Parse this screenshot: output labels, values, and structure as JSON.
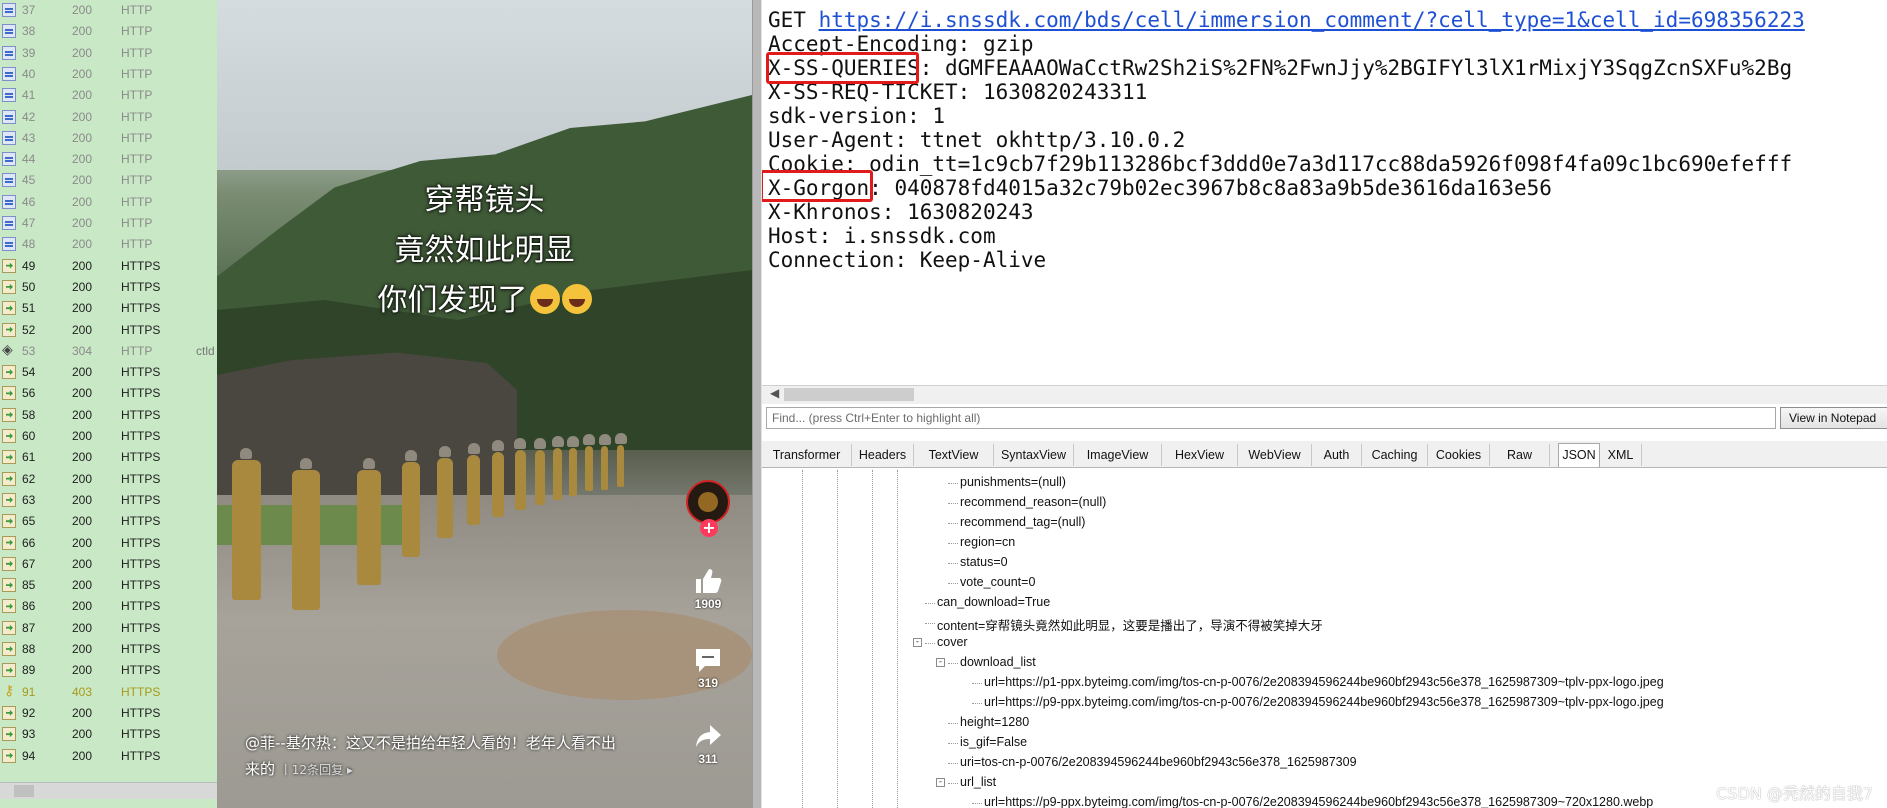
{
  "sessions": [
    {
      "num": "37",
      "code": "200",
      "proto": "HTTP",
      "icon": "http",
      "host": ""
    },
    {
      "num": "38",
      "code": "200",
      "proto": "HTTP",
      "icon": "http",
      "host": ""
    },
    {
      "num": "39",
      "code": "200",
      "proto": "HTTP",
      "icon": "http",
      "host": ""
    },
    {
      "num": "40",
      "code": "200",
      "proto": "HTTP",
      "icon": "http",
      "host": ""
    },
    {
      "num": "41",
      "code": "200",
      "proto": "HTTP",
      "icon": "http",
      "host": ""
    },
    {
      "num": "42",
      "code": "200",
      "proto": "HTTP",
      "icon": "http",
      "host": ""
    },
    {
      "num": "43",
      "code": "200",
      "proto": "HTTP",
      "icon": "http",
      "host": ""
    },
    {
      "num": "44",
      "code": "200",
      "proto": "HTTP",
      "icon": "http",
      "host": ""
    },
    {
      "num": "45",
      "code": "200",
      "proto": "HTTP",
      "icon": "http",
      "host": ""
    },
    {
      "num": "46",
      "code": "200",
      "proto": "HTTP",
      "icon": "http",
      "host": ""
    },
    {
      "num": "47",
      "code": "200",
      "proto": "HTTP",
      "icon": "http",
      "host": ""
    },
    {
      "num": "48",
      "code": "200",
      "proto": "HTTP",
      "icon": "http",
      "host": ""
    },
    {
      "num": "49",
      "code": "200",
      "proto": "HTTPS",
      "icon": "https",
      "host": ""
    },
    {
      "num": "50",
      "code": "200",
      "proto": "HTTPS",
      "icon": "https",
      "host": ""
    },
    {
      "num": "51",
      "code": "200",
      "proto": "HTTPS",
      "icon": "https",
      "host": ""
    },
    {
      "num": "52",
      "code": "200",
      "proto": "HTTPS",
      "icon": "https",
      "host": ""
    },
    {
      "num": "53",
      "code": "304",
      "proto": "HTTP",
      "icon": "c304",
      "host": "ctld"
    },
    {
      "num": "54",
      "code": "200",
      "proto": "HTTPS",
      "icon": "https",
      "host": ""
    },
    {
      "num": "56",
      "code": "200",
      "proto": "HTTPS",
      "icon": "https",
      "host": ""
    },
    {
      "num": "58",
      "code": "200",
      "proto": "HTTPS",
      "icon": "https",
      "host": ""
    },
    {
      "num": "60",
      "code": "200",
      "proto": "HTTPS",
      "icon": "https",
      "host": ""
    },
    {
      "num": "61",
      "code": "200",
      "proto": "HTTPS",
      "icon": "https",
      "host": ""
    },
    {
      "num": "62",
      "code": "200",
      "proto": "HTTPS",
      "icon": "https",
      "host": ""
    },
    {
      "num": "63",
      "code": "200",
      "proto": "HTTPS",
      "icon": "https",
      "host": ""
    },
    {
      "num": "65",
      "code": "200",
      "proto": "HTTPS",
      "icon": "https",
      "host": ""
    },
    {
      "num": "66",
      "code": "200",
      "proto": "HTTPS",
      "icon": "https",
      "host": ""
    },
    {
      "num": "67",
      "code": "200",
      "proto": "HTTPS",
      "icon": "https",
      "host": ""
    },
    {
      "num": "85",
      "code": "200",
      "proto": "HTTPS",
      "icon": "https",
      "host": ""
    },
    {
      "num": "86",
      "code": "200",
      "proto": "HTTPS",
      "icon": "https",
      "host": ""
    },
    {
      "num": "87",
      "code": "200",
      "proto": "HTTPS",
      "icon": "https",
      "host": ""
    },
    {
      "num": "88",
      "code": "200",
      "proto": "HTTPS",
      "icon": "https",
      "host": ""
    },
    {
      "num": "89",
      "code": "200",
      "proto": "HTTPS",
      "icon": "https",
      "host": ""
    },
    {
      "num": "91",
      "code": "403",
      "proto": "HTTPS",
      "icon": "c403",
      "host": ""
    },
    {
      "num": "92",
      "code": "200",
      "proto": "HTTPS",
      "icon": "https",
      "host": ""
    },
    {
      "num": "93",
      "code": "200",
      "proto": "HTTPS",
      "icon": "https",
      "host": ""
    },
    {
      "num": "94",
      "code": "200",
      "proto": "HTTPS",
      "icon": "https",
      "host": ""
    }
  ],
  "video": {
    "caption_lines": [
      "穿帮镜头",
      "竟然如此明显",
      "你们发现了"
    ],
    "like_count": "1909",
    "comment_count": "319",
    "share_count": "311",
    "follow_symbol": "+",
    "comment_line1": "@菲--基尔热：这又不是拍给年轻人看的！老年人看不出",
    "comment_line2": "来的",
    "comment_replies": "丨12条回复 ▸"
  },
  "request": {
    "method": "GET",
    "url": "https://i.snssdk.com/bds/cell/immersion_comment/?cell_type=1&cell_id=698356223",
    "headers": [
      {
        "name": "Accept-Encoding",
        "value": "gzip"
      },
      {
        "name": "X-SS-QUERIES",
        "value": "dGMFEAAAOWaCctRw2Sh2iS%2FN%2FwnJjy%2BGIFYl3lX1rMixjY3SqgZcnSXFu%2Bg"
      },
      {
        "name": "X-SS-REQ-TICKET",
        "value": "1630820243311"
      },
      {
        "name": "sdk-version",
        "value": "1"
      },
      {
        "name": "User-Agent",
        "value": "ttnet okhttp/3.10.0.2"
      },
      {
        "name": "Cookie",
        "value": "odin_tt=1c9cb7f29b113286bcf3ddd0e7a3d117cc88da5926f098f4fa09c1bc690efefff"
      },
      {
        "name": "X-Gorgon",
        "value": "040878fd4015a32c79b02ec3967b8c8a83a9b5de3616da163e56"
      },
      {
        "name": "X-Khronos",
        "value": "1630820243"
      },
      {
        "name": "Host",
        "value": "i.snssdk.com"
      },
      {
        "name": "Connection",
        "value": "Keep-Alive"
      }
    ]
  },
  "find": {
    "placeholder": "Find... (press Ctrl+Enter to highlight all)",
    "notepad_label": "View in Notepad"
  },
  "tabs": [
    "Transformer",
    "Headers",
    "TextView",
    "SyntaxView",
    "ImageView",
    "HexView",
    "WebView",
    "Auth",
    "Caching",
    "Cookies",
    "Raw",
    "JSON",
    "XML"
  ],
  "active_tab": "JSON",
  "tree": [
    {
      "text": "punishments=(null)",
      "indent": 3,
      "expander": ""
    },
    {
      "text": "recommend_reason=(null)",
      "indent": 3,
      "expander": ""
    },
    {
      "text": "recommend_tag=(null)",
      "indent": 3,
      "expander": ""
    },
    {
      "text": "region=cn",
      "indent": 3,
      "expander": ""
    },
    {
      "text": "status=0",
      "indent": 3,
      "expander": ""
    },
    {
      "text": "vote_count=0",
      "indent": 3,
      "expander": ""
    },
    {
      "text": "can_download=True",
      "indent": 2,
      "expander": ""
    },
    {
      "text": "content=穿帮镜头竟然如此明显，这要是播出了，导演不得被笑掉大牙",
      "indent": 2,
      "expander": ""
    },
    {
      "text": "cover",
      "indent": 2,
      "expander": "-"
    },
    {
      "text": "download_list",
      "indent": 3,
      "expander": "-"
    },
    {
      "text": "url=https://p1-ppx.byteimg.com/img/tos-cn-p-0076/2e208394596244be960bf2943c56e378_1625987309~tplv-ppx-logo.jpeg",
      "indent": 4,
      "expander": ""
    },
    {
      "text": "url=https://p9-ppx.byteimg.com/img/tos-cn-p-0076/2e208394596244be960bf2943c56e378_1625987309~tplv-ppx-logo.jpeg",
      "indent": 4,
      "expander": ""
    },
    {
      "text": "height=1280",
      "indent": 3,
      "expander": ""
    },
    {
      "text": "is_gif=False",
      "indent": 3,
      "expander": ""
    },
    {
      "text": "uri=tos-cn-p-0076/2e208394596244be960bf2943c56e378_1625987309",
      "indent": 3,
      "expander": ""
    },
    {
      "text": "url_list",
      "indent": 3,
      "expander": "-"
    },
    {
      "text": "url=https://p9-ppx.byteimg.com/img/tos-cn-p-0076/2e208394596244be960bf2943c56e378_1625987309~720x1280.webp",
      "indent": 4,
      "expander": ""
    }
  ],
  "watermark": "CSDN @秃然的自我7",
  "colors": {
    "session_bg": "#c9e8c6",
    "highlight_box": "#e11b1b",
    "link": "#1d50d4"
  }
}
